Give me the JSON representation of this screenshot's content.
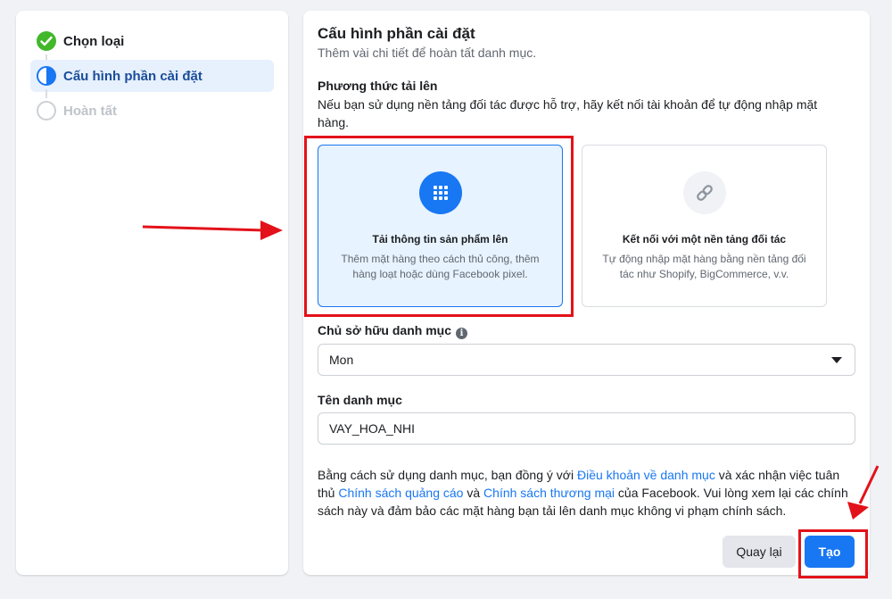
{
  "steps": [
    {
      "label": "Chọn loại",
      "state": "done"
    },
    {
      "label": "Cấu hình phần cài đặt",
      "state": "active"
    },
    {
      "label": "Hoàn tất",
      "state": "pending"
    }
  ],
  "header": {
    "title": "Cấu hình phần cài đặt",
    "subtitle": "Thêm vài chi tiết để hoàn tất danh mục."
  },
  "upload_method": {
    "title": "Phương thức tải lên",
    "description": "Nếu bạn sử dụng nền tảng đối tác được hỗ trợ, hãy kết nối tài khoản để tự động nhập mặt hàng.",
    "options": [
      {
        "title": "Tải thông tin sản phẩm lên",
        "description": "Thêm mặt hàng theo cách thủ công, thêm hàng loạt hoặc dùng Facebook pixel.",
        "icon": "grid-icon",
        "selected": true
      },
      {
        "title": "Kết nối với một nền tảng đối tác",
        "description": "Tự động nhập mặt hàng bằng nền tảng đối tác như Shopify, BigCommerce, v.v.",
        "icon": "link-icon",
        "selected": false
      }
    ]
  },
  "owner": {
    "label": "Chủ sở hữu danh mục",
    "value": "Mon"
  },
  "catalog_name": {
    "label": "Tên danh mục",
    "value": "VAY_HOA_NHI"
  },
  "terms": {
    "t1": "Bằng cách sử dụng danh mục, bạn đồng ý với ",
    "link1": "Điều khoản về danh mục",
    "t2": " và xác nhận việc tuân thủ ",
    "link2": "Chính sách quảng cáo",
    "t3": " và ",
    "link3": "Chính sách thương mại",
    "t4": " của Facebook. Vui lòng xem lại các chính sách này và đảm bảo các mặt hàng bạn tải lên danh mục không vi phạm chính sách."
  },
  "buttons": {
    "back": "Quay lại",
    "create": "Tạo"
  },
  "colors": {
    "accent": "#1877f2",
    "success": "#42b72a",
    "annotation": "#e3121a"
  }
}
